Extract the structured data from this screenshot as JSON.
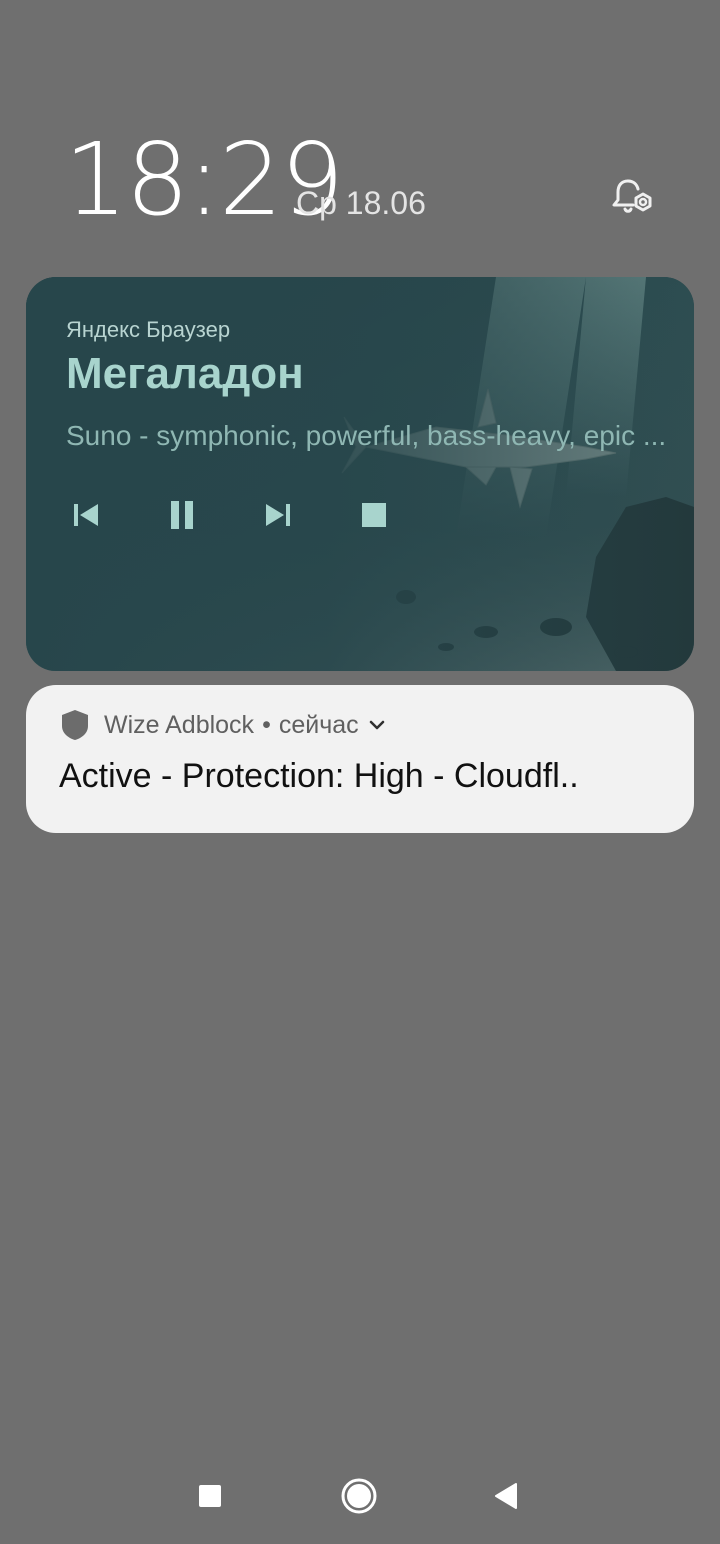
{
  "status": {
    "time": "18:29",
    "date": "Ср 18.06"
  },
  "media": {
    "app_name": "Яндекс Браузер",
    "title": "Мегаладон",
    "subtitle": "Suno - symphonic, powerful, bass-heavy, epic ...",
    "controls": {
      "previous": "skip-previous-icon",
      "pause": "pause-icon",
      "next": "skip-next-icon",
      "stop": "stop-icon"
    },
    "accent_color": "#a8d4cd",
    "background_color": "#27464b"
  },
  "notification": {
    "app_name": "Wize Adblock",
    "separator": "•",
    "time": "сейчас",
    "text": "Active - Protection: High - Cloudfl.."
  },
  "icons": {
    "header_action": "notification-settings-icon",
    "nav_recents": "recents-square-icon",
    "nav_home": "home-circle-icon",
    "nav_back": "back-triangle-icon"
  }
}
